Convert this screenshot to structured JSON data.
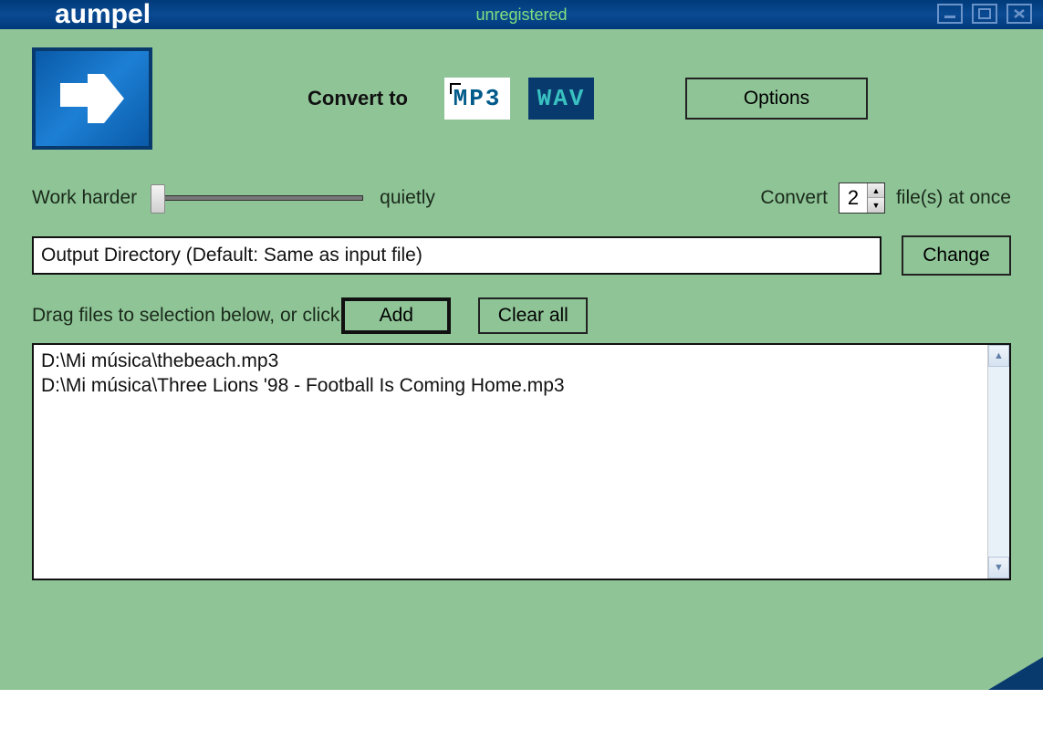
{
  "titlebar": {
    "brand": "aumpel",
    "status": "unregistered"
  },
  "convert": {
    "label": "Convert to",
    "mp3": "MP3",
    "wav": "WAV",
    "options": "Options"
  },
  "slider": {
    "left": "Work harder",
    "right": "quietly"
  },
  "concurrent": {
    "prefix": "Convert",
    "value": "2",
    "suffix": "file(s) at once"
  },
  "outdir": {
    "value": "Output Directory (Default: Same as input file)",
    "change": "Change"
  },
  "drag": {
    "text": "Drag files to selection below, or click",
    "add": "Add",
    "clear": "Clear all"
  },
  "files": [
    "D:\\Mi música\\thebeach.mp3",
    "D:\\Mi música\\Three Lions '98 - Football Is Coming Home.mp3"
  ]
}
